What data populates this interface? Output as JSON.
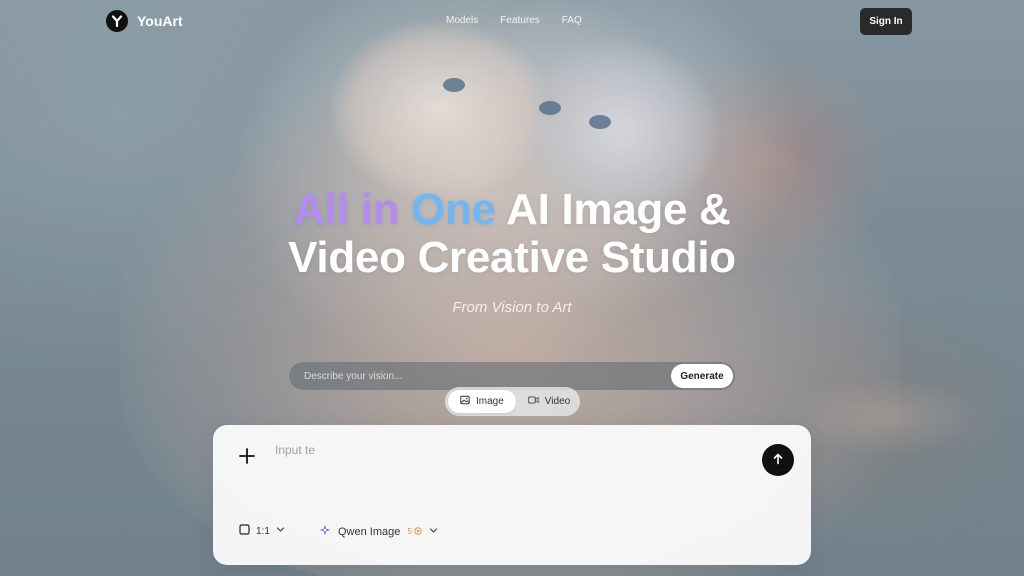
{
  "header": {
    "brand": "YouArt",
    "nav": [
      "Models",
      "Features",
      "FAQ"
    ],
    "sign_in": "Sign In"
  },
  "hero": {
    "title_part1": "All in",
    "title_part2": "One",
    "title_part3": "AI Image &",
    "title_line2": "Video Creative Studio",
    "subtitle": "From Vision to Art"
  },
  "prompt_bar": {
    "placeholder": "Describe your vision...",
    "generate_label": "Generate"
  },
  "mode_toggle": {
    "image_label": "Image",
    "video_label": "Video",
    "selected": "Image"
  },
  "card": {
    "input_placeholder": "Input te",
    "ratio": "1:1",
    "model": "Qwen Image",
    "credits": "5"
  },
  "colors": {
    "accent_purple": "#b48cf0",
    "accent_blue": "#6fb6f2",
    "button_dark": "#2a2a2a",
    "credit_orange": "#e09545"
  },
  "icons": {
    "logo": "y-logo-icon",
    "image_mode": "image-icon",
    "video_mode": "video-camera-icon",
    "add": "plus-icon",
    "send": "arrow-up-icon",
    "ratio": "square-icon",
    "model": "model-sparkle-icon",
    "credits": "coin-icon",
    "dropdown": "chevron-down-icon"
  }
}
